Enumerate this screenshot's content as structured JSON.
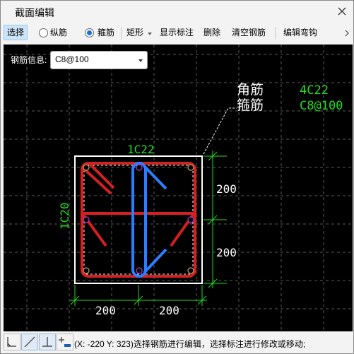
{
  "window": {
    "title": "截面编辑"
  },
  "toolbar": {
    "select_label": "选择",
    "longitudinal_label": "纵筋",
    "stirrup_label": "箍筋",
    "shape_label": "矩形",
    "show_dim_label": "显示标注",
    "delete_label": "删除",
    "clear_label": "清空钢筋",
    "edit_hook_label": "编辑弯钩",
    "selected_mode": "stirrup"
  },
  "info": {
    "label": "钢筋信息:",
    "value": "C8@100"
  },
  "drawing": {
    "legend_corner_label": "角筋",
    "legend_stirrup_label": "箍筋",
    "legend_corner_value": "4C22",
    "legend_stirrup_value": "C8@100",
    "top_bar_label": "1C22",
    "side_bar_label": "1C20",
    "dim_right_top": "200",
    "dim_right_bottom": "200",
    "dim_bottom_left": "200",
    "dim_bottom_right": "200",
    "colors": {
      "stirrup": "#d42020",
      "tie": "#2a7fff",
      "dim": "#22dd22",
      "text": "#ffffff",
      "section": "#ffffff"
    }
  },
  "status": {
    "text": "(X: -220 Y: 323)选择钢筋进行编辑，选择标注进行修改或移动;"
  }
}
